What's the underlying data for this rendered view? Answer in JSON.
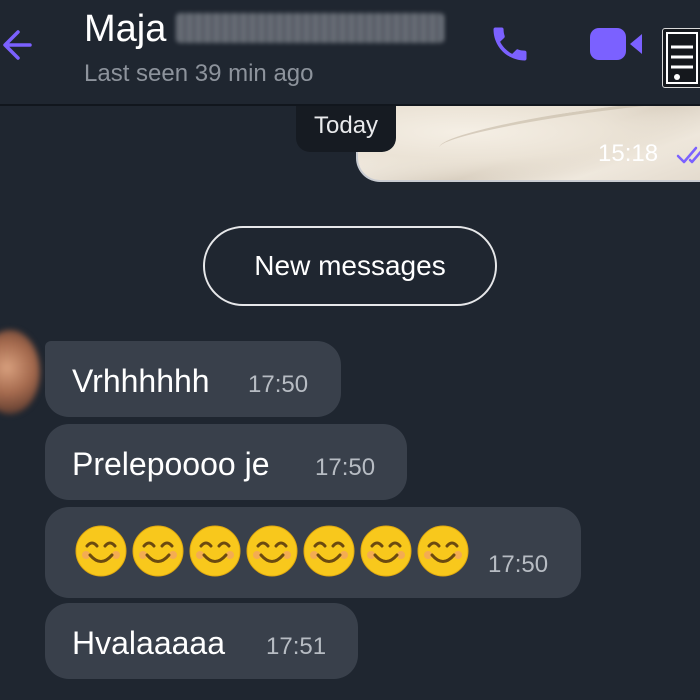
{
  "header": {
    "contact_first_name": "Maja",
    "last_seen": "Last seen 39 min ago",
    "accent_color": "#7b61ff"
  },
  "image_message": {
    "time": "15:18",
    "status": "read"
  },
  "date_divider": "Today",
  "new_messages_label": "New messages",
  "messages": [
    {
      "text": "Vrhhhhhh",
      "time": "17:50"
    },
    {
      "text": "Prelepoooo je",
      "time": "17:50"
    },
    {
      "emoji_count": 7,
      "emoji": "smiling-face",
      "time": "17:50"
    },
    {
      "text": "Hvalaaaaa",
      "time": "17:51"
    }
  ]
}
